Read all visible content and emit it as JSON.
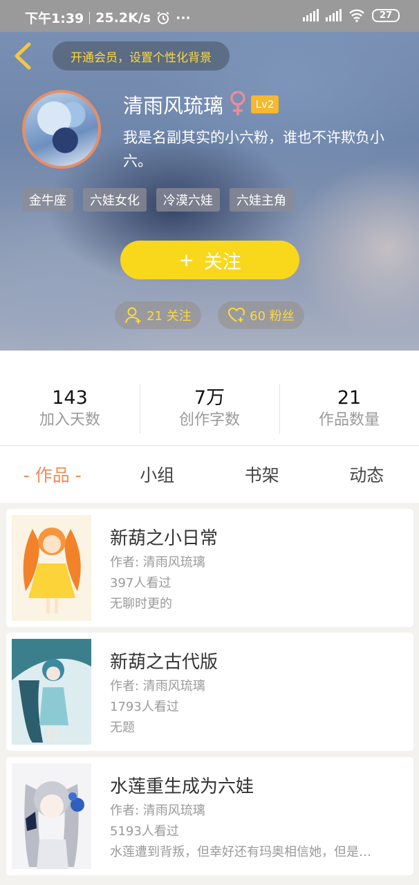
{
  "status_bar": {
    "time": "下午1:39",
    "speed": "25.2K/s",
    "more": "···",
    "battery": "27"
  },
  "header": {
    "vip_prompt": "开通会员，设置个性化背景"
  },
  "profile": {
    "name": "清雨风琉璃",
    "level": "Lv2",
    "bio": "我是名副其实的小六粉，谁也不许欺负小六。",
    "tags": [
      "金牛座",
      "六娃女化",
      "冷漠六娃",
      "六娃主角"
    ],
    "follow_plus": "+",
    "follow_label": "关注",
    "following": "21 关注",
    "fans": "60 粉丝"
  },
  "stats": [
    {
      "value": "143",
      "label": "加入天数"
    },
    {
      "value": "7万",
      "label": "创作字数"
    },
    {
      "value": "21",
      "label": "作品数量"
    }
  ],
  "tabs": [
    "- 作品 -",
    "小组",
    "书架",
    "动态"
  ],
  "works": [
    {
      "title": "新葫之小日常",
      "author": "作者: 清雨风琉璃",
      "views": "397人看过",
      "desc": "无聊时更的"
    },
    {
      "title": "新葫之古代版",
      "author": "作者: 清雨风琉璃",
      "views": "1793人看过",
      "desc": "无题"
    },
    {
      "title": "水莲重生成为六娃",
      "author": "作者: 清雨风琉璃",
      "views": "5193人看过",
      "desc": "水莲遭到背叛，但幸好还有玛奥相信她，但是…"
    }
  ],
  "colors": {
    "accent": "#ef8c56",
    "follow": "#f9d81b",
    "level": "#f5b830",
    "vip_text": "#ffd93d"
  }
}
